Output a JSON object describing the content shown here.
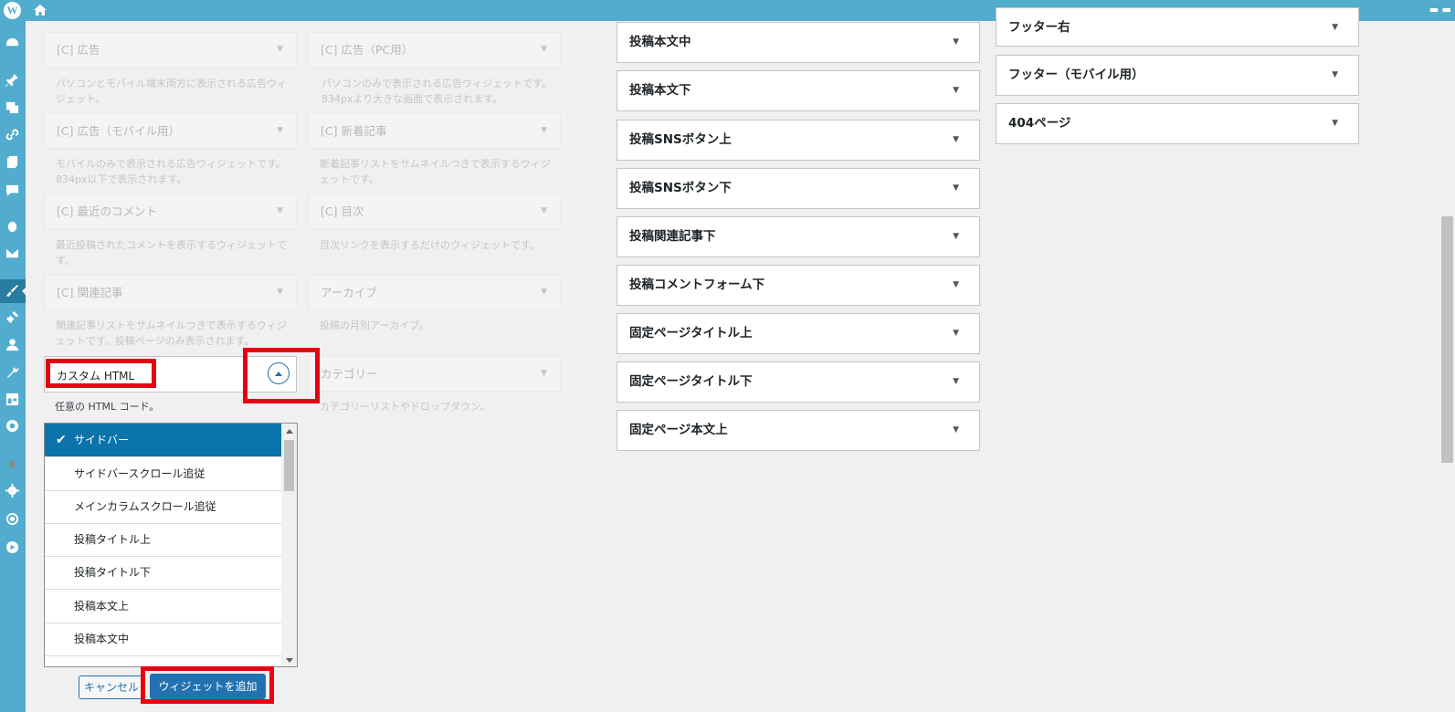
{
  "available_widgets": [
    {
      "title": "[C] 広告",
      "desc": "パソコンとモバイル端末両方に表示される広告ウィジェット。"
    },
    {
      "title": "[C] 広告（PC用）",
      "desc": "パソコンのみで表示される広告ウィジェットです。834pxより大きな画面で表示されます。"
    },
    {
      "title": "[C] 広告（モバイル用）",
      "desc": "モバイルのみで表示される広告ウィジェットです。834px以下で表示されます。"
    },
    {
      "title": "[C] 新着記事",
      "desc": "新着記事リストをサムネイルつきで表示するウィジェットです。"
    },
    {
      "title": "[C] 最近のコメント",
      "desc": "最近投稿されたコメントを表示するウィジェットです。"
    },
    {
      "title": "[C] 目次",
      "desc": "目次リンクを表示するだけのウィジェットです。"
    },
    {
      "title": "[C] 関連記事",
      "desc": "関連記事リストをサムネイルつきで表示するウィジェットです。投稿ページのみ表示されます。"
    },
    {
      "title": "アーカイブ",
      "desc": "投稿の月別アーカイブ。"
    },
    {
      "title": "カテゴリー",
      "desc": "カテゴリーリストやドロップダウン。"
    }
  ],
  "custom_html": {
    "title": "カスタム HTML",
    "desc": "任意の HTML コード。",
    "options": [
      "サイドバー",
      "サイドバースクロール追従",
      "メインカラムスクロール追従",
      "投稿タイトル上",
      "投稿タイトル下",
      "投稿本文上",
      "投稿本文中"
    ],
    "selected_check": "✔",
    "cancel_label": "キャンセル",
    "add_label": "ウィジェットを追加"
  },
  "areas_mid": [
    "投稿本文中",
    "投稿本文下",
    "投稿SNSボタン上",
    "投稿SNSボタン下",
    "投稿関連記事下",
    "投稿コメントフォーム下",
    "固定ページタイトル上",
    "固定ページタイトル下",
    "固定ページ本文上"
  ],
  "areas_right": [
    "フッター右",
    "フッター（モバイル用）",
    "404ページ"
  ],
  "colors": {
    "admin_bar": "#52accd",
    "selected": "#0a73aa",
    "highlight_border": "#e60012",
    "button_primary": "#2271b1"
  }
}
